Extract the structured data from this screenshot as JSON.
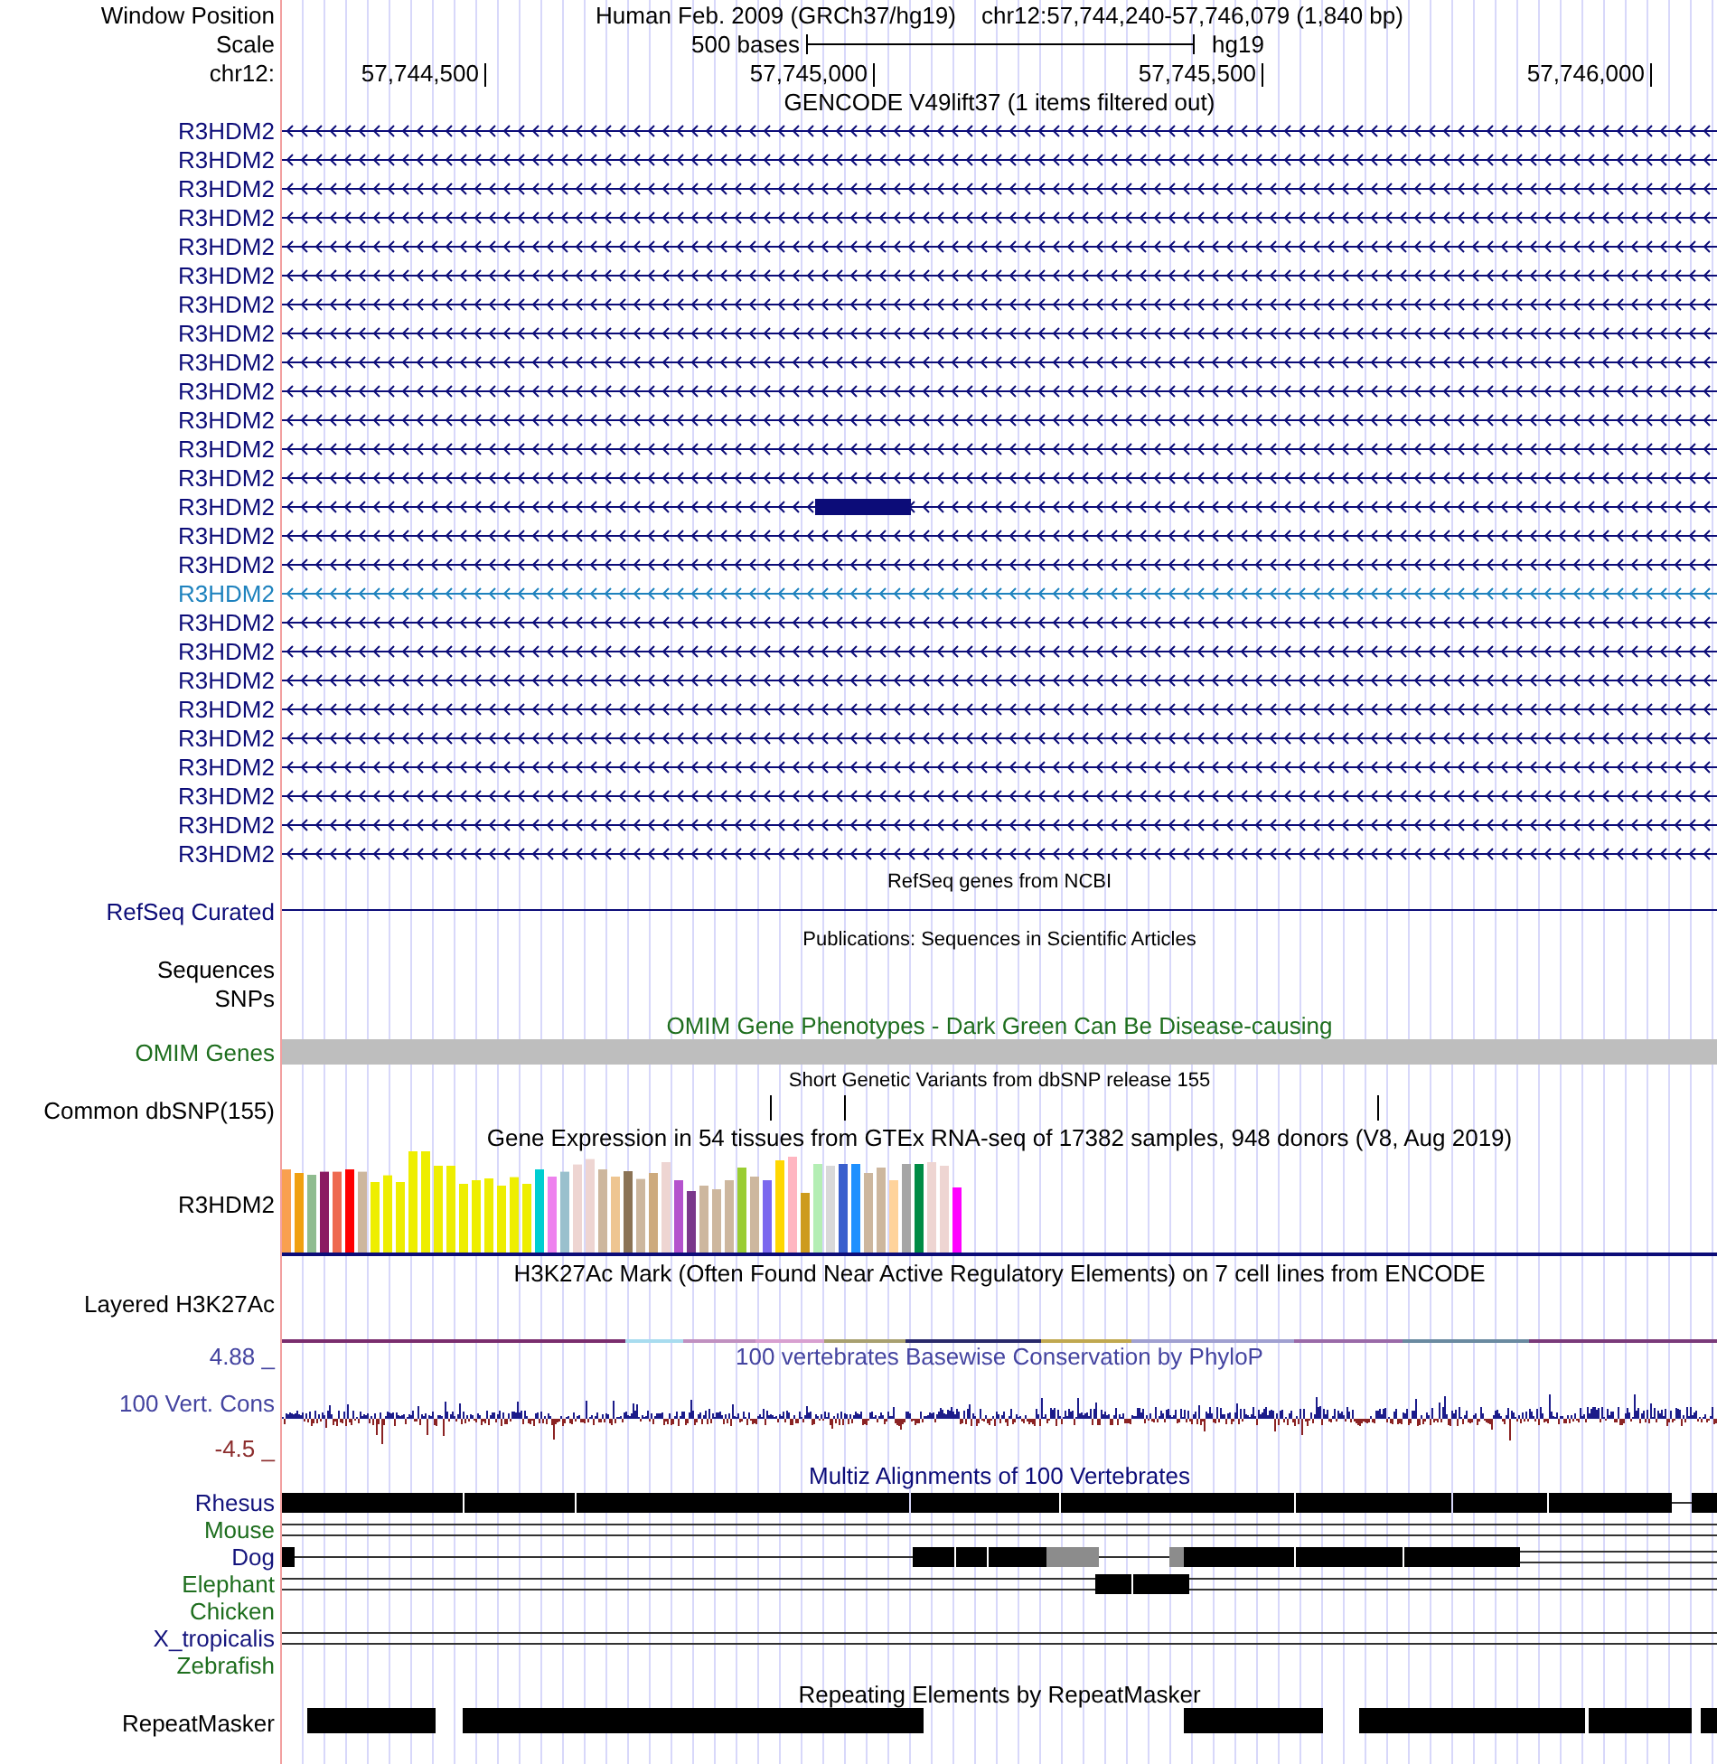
{
  "position": {
    "label": "Window Position",
    "assembly": "Human Feb. 2009 (GRCh37/hg19)",
    "range": "chr12:57,744,240-57,746,079 (1,840 bp)"
  },
  "scale": {
    "label": "Scale",
    "length": "500 bases",
    "assembly": "hg19"
  },
  "ruler": {
    "label": "chr12:",
    "ticks": [
      "57,744,500",
      "57,745,000",
      "57,745,500",
      "57,746,000"
    ]
  },
  "gencode": {
    "title": "GENCODE V49lift37 (1 items filtered out)",
    "transcripts": [
      {
        "label": "R3HDM2",
        "color": "#0c0c78",
        "kind": "line"
      },
      {
        "label": "R3HDM2",
        "color": "#0c0c78",
        "kind": "line"
      },
      {
        "label": "R3HDM2",
        "color": "#0c0c78",
        "kind": "line"
      },
      {
        "label": "R3HDM2",
        "color": "#0c0c78",
        "kind": "line"
      },
      {
        "label": "R3HDM2",
        "color": "#0c0c78",
        "kind": "line"
      },
      {
        "label": "R3HDM2",
        "color": "#0c0c78",
        "kind": "line"
      },
      {
        "label": "R3HDM2",
        "color": "#0c0c78",
        "kind": "line"
      },
      {
        "label": "R3HDM2",
        "color": "#0c0c78",
        "kind": "line"
      },
      {
        "label": "R3HDM2",
        "color": "#0c0c78",
        "kind": "line"
      },
      {
        "label": "R3HDM2",
        "color": "#0c0c78",
        "kind": "line"
      },
      {
        "label": "R3HDM2",
        "color": "#0c0c78",
        "kind": "line"
      },
      {
        "label": "R3HDM2",
        "color": "#0c0c78",
        "kind": "line"
      },
      {
        "label": "R3HDM2",
        "color": "#0c0c78",
        "kind": "line"
      },
      {
        "label": "R3HDM2",
        "color": "#0c0c78",
        "kind": "exon"
      },
      {
        "label": "R3HDM2",
        "color": "#0c0c78",
        "kind": "line"
      },
      {
        "label": "R3HDM2",
        "color": "#0c0c78",
        "kind": "line"
      },
      {
        "label": "R3HDM2",
        "color": "#1e82be",
        "kind": "line"
      },
      {
        "label": "R3HDM2",
        "color": "#0c0c78",
        "kind": "line"
      },
      {
        "label": "R3HDM2",
        "color": "#0c0c78",
        "kind": "line"
      },
      {
        "label": "R3HDM2",
        "color": "#0c0c78",
        "kind": "line"
      },
      {
        "label": "R3HDM2",
        "color": "#0c0c78",
        "kind": "line"
      },
      {
        "label": "R3HDM2",
        "color": "#0c0c78",
        "kind": "line"
      },
      {
        "label": "R3HDM2",
        "color": "#0c0c78",
        "kind": "line"
      },
      {
        "label": "R3HDM2",
        "color": "#0c0c78",
        "kind": "line"
      },
      {
        "label": "R3HDM2",
        "color": "#0c0c78",
        "kind": "line"
      },
      {
        "label": "R3HDM2",
        "color": "#0c0c78",
        "kind": "line"
      }
    ]
  },
  "refseq": {
    "title": "RefSeq genes from NCBI",
    "label": "RefSeq Curated"
  },
  "publications": {
    "title": "Publications: Sequences in Scientific Articles",
    "labels": [
      "Sequences",
      "SNPs"
    ]
  },
  "omim": {
    "title": "OMIM Gene Phenotypes - Dark Green Can Be Disease-causing",
    "label": "OMIM Genes"
  },
  "dbsnp": {
    "title": "Short Genetic Variants from dbSNP release 155",
    "label": "Common dbSNP(155)"
  },
  "gtex": {
    "title": "Gene Expression in 54 tissues from GTEx RNA-seq of 17382 samples, 948 donors (V8, Aug 2019)",
    "label": "R3HDM2"
  },
  "h3k27ac": {
    "title": "H3K27Ac Mark (Often Found Near Active Regulatory Elements) on 7 cell lines from ENCODE",
    "label": "Layered H3K27Ac"
  },
  "conservation": {
    "title": "100 vertebrates Basewise Conservation by PhyloP",
    "label": "100 Vert. Cons",
    "max": "4.88 _",
    "min": "-4.5 _"
  },
  "multiz": {
    "title": "Multiz Alignments of 100 Vertebrates",
    "species": [
      {
        "label": "Rhesus",
        "color": "#14147d"
      },
      {
        "label": "Mouse",
        "color": "#1e6e1e"
      },
      {
        "label": "Dog",
        "color": "#14147d"
      },
      {
        "label": "Elephant",
        "color": "#1e6e1e"
      },
      {
        "label": "Chicken",
        "color": "#1e6e1e"
      },
      {
        "label": "X_tropicalis",
        "color": "#14147d"
      },
      {
        "label": "Zebrafish",
        "color": "#1e6e1e"
      }
    ]
  },
  "repeatmasker": {
    "title": "Repeating Elements by RepeatMasker",
    "label": "RepeatMasker"
  }
}
